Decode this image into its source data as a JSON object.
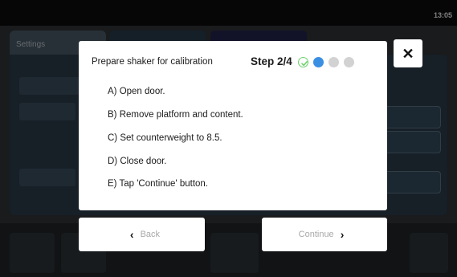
{
  "status_bar": {
    "time": "13:05"
  },
  "background": {
    "tab_label": "Settings"
  },
  "dialog": {
    "title": "Prepare shaker for calibration",
    "step_label": "Step 2/4",
    "steps_total": 4,
    "current_step": 2,
    "step_colors": {
      "done": "#6cd36a",
      "current": "#3b8fe3",
      "pending": "#d2d2d2"
    },
    "instructions": [
      "A) Open door.",
      "B) Remove platform and content.",
      "C) Set counterweight to 8.5.",
      "D) Close door.",
      "E) Tap 'Continue' button."
    ],
    "close_icon": "close-icon"
  },
  "navigation": {
    "back_label": "Back",
    "continue_label": "Continue",
    "back_icon": "chevron-left-icon",
    "continue_icon": "chevron-right-icon"
  }
}
